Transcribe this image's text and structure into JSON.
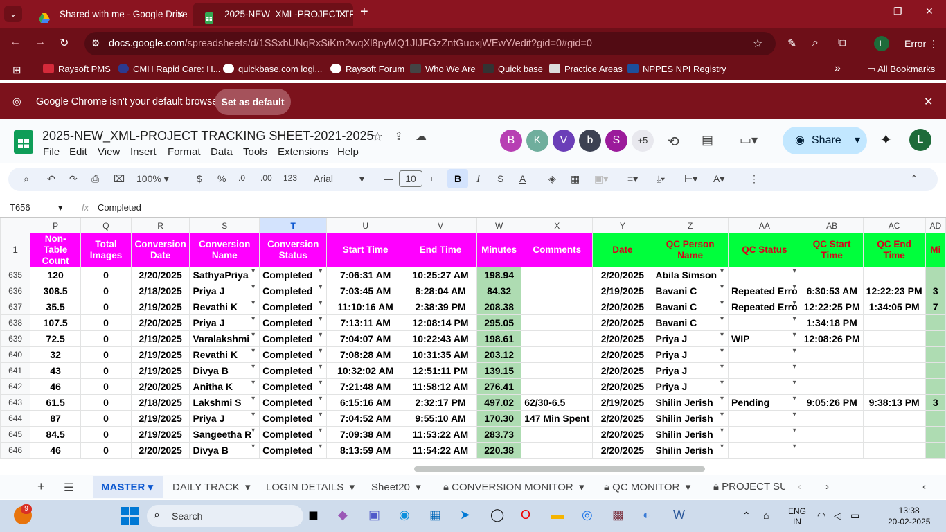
{
  "browser": {
    "tabs": [
      {
        "title": "Shared with me - Google Drive",
        "icon": "google-drive-icon"
      },
      {
        "title": "2025-NEW_XML-PROJECT TRAC",
        "icon": "google-sheets-icon"
      }
    ],
    "url_host": "docs.google.com",
    "url_path": "/spreadsheets/d/1SSxbUNqRxSiKm2wqXl8pyMQ1JlJFGzZntGuoxjWEwY/edit?gid=0#gid=0",
    "profile_initial": "L",
    "error_label": "Error",
    "bookmarks": [
      "Raysoft PMS",
      "CMH Rapid Care: H...",
      "quickbase.com logi...",
      "Raysoft Forum",
      "Who We Are",
      "Quick base",
      "Practice Areas",
      "NPPES NPI Registry"
    ],
    "all_bookmarks": "All Bookmarks",
    "infobar_text": "Google Chrome isn't your default browser",
    "set_default": "Set as default"
  },
  "sheet": {
    "title": "2025-NEW_XML-PROJECT TRACKING SHEET-2021-2025",
    "menu": [
      "File",
      "Edit",
      "View",
      "Insert",
      "Format",
      "Data",
      "Tools",
      "Extensions",
      "Help"
    ],
    "collaborators": [
      "B",
      "K",
      "V",
      "b",
      "S"
    ],
    "more_collaborators": "+5",
    "share_label": "Share",
    "user_initial": "L",
    "zoom": "100%",
    "currency": "$",
    "percent": "%",
    "dec_less": ".0",
    "dec_more": ".00",
    "number_fmt": "123",
    "font": "Arial",
    "font_size": "10",
    "name_box": "T656",
    "formula": "Completed",
    "columns": [
      "P",
      "Q",
      "R",
      "S",
      "T",
      "U",
      "V",
      "W",
      "X",
      "Y",
      "Z",
      "AA",
      "AB",
      "AC",
      "AD"
    ],
    "header_row_number": "1",
    "headers": [
      "Non-Table Count",
      "Total Images",
      "Conversion Date",
      "Conversion Name",
      "Conversion Status",
      "Start Time",
      "End Time",
      "Minutes",
      "Comments",
      "Date",
      "QC Person Name",
      "QC Status",
      "QC Start Time",
      "QC End Time",
      "Mi"
    ],
    "rows": [
      {
        "n": "635",
        "c": [
          "120",
          "0",
          "2/20/2025",
          "SathyaPriya",
          "Completed",
          "7:06:31 AM",
          "10:25:27 AM",
          "198.94",
          "",
          "2/20/2025",
          "Abila Simson",
          "",
          "",
          "",
          ""
        ]
      },
      {
        "n": "636",
        "c": [
          "308.5",
          "0",
          "2/18/2025",
          "Priya J",
          "Completed",
          "7:03:45 AM",
          "8:28:04 AM",
          "84.32",
          "",
          "2/19/2025",
          "Bavani C",
          "Repeated Erro",
          "6:30:53 AM",
          "12:22:23 PM",
          "3"
        ]
      },
      {
        "n": "637",
        "c": [
          "35.5",
          "0",
          "2/19/2025",
          "Revathi K",
          "Completed",
          "11:10:16 AM",
          "2:38:39 PM",
          "208.38",
          "",
          "2/20/2025",
          "Bavani C",
          "Repeated Erro",
          "12:22:25 PM",
          "1:34:05 PM",
          "7"
        ]
      },
      {
        "n": "638",
        "c": [
          "107.5",
          "0",
          "2/20/2025",
          "Priya J",
          "Completed",
          "7:13:11 AM",
          "12:08:14 PM",
          "295.05",
          "",
          "2/20/2025",
          "Bavani C",
          "",
          "1:34:18 PM",
          "",
          ""
        ]
      },
      {
        "n": "639",
        "c": [
          "72.5",
          "0",
          "2/19/2025",
          "Varalakshmi",
          "Completed",
          "7:04:07 AM",
          "10:22:43 AM",
          "198.61",
          "",
          "2/20/2025",
          "Priya J",
          "WIP",
          "12:08:26 PM",
          "",
          ""
        ]
      },
      {
        "n": "640",
        "c": [
          "32",
          "0",
          "2/19/2025",
          "Revathi K",
          "Completed",
          "7:08:28 AM",
          "10:31:35 AM",
          "203.12",
          "",
          "2/20/2025",
          "Priya J",
          "",
          "",
          "",
          ""
        ]
      },
      {
        "n": "641",
        "c": [
          "43",
          "0",
          "2/19/2025",
          "Divya B",
          "Completed",
          "10:32:02 AM",
          "12:51:11 PM",
          "139.15",
          "",
          "2/20/2025",
          "Priya J",
          "",
          "",
          "",
          ""
        ]
      },
      {
        "n": "642",
        "c": [
          "46",
          "0",
          "2/20/2025",
          "Anitha K",
          "Completed",
          "7:21:48 AM",
          "11:58:12 AM",
          "276.41",
          "",
          "2/20/2025",
          "Priya J",
          "",
          "",
          "",
          ""
        ]
      },
      {
        "n": "643",
        "c": [
          "61.5",
          "0",
          "2/18/2025",
          "Lakshmi S",
          "Completed",
          "6:15:16 AM",
          "2:32:17 PM",
          "497.02",
          "62/30-6.5",
          "2/19/2025",
          "Shilin Jerish",
          "Pending",
          "9:05:26 PM",
          "9:38:13 PM",
          "3"
        ]
      },
      {
        "n": "644",
        "c": [
          "87",
          "0",
          "2/19/2025",
          "Priya J",
          "Completed",
          "7:04:52 AM",
          "9:55:10 AM",
          "170.30",
          "147 Min Spent",
          "2/20/2025",
          "Shilin Jerish",
          "",
          "",
          "",
          ""
        ]
      },
      {
        "n": "645",
        "c": [
          "84.5",
          "0",
          "2/19/2025",
          "Sangeetha R",
          "Completed",
          "7:09:38 AM",
          "11:53:22 AM",
          "283.73",
          "",
          "2/20/2025",
          "Shilin Jerish",
          "",
          "",
          "",
          ""
        ]
      },
      {
        "n": "646",
        "c": [
          "46",
          "0",
          "2/20/2025",
          "Divya B",
          "Completed",
          "8:13:59 AM",
          "11:54:22 AM",
          "220.38",
          "",
          "2/20/2025",
          "Shilin Jerish",
          "",
          "",
          "",
          ""
        ]
      }
    ],
    "sheet_tabs": [
      "MASTER",
      "DAILY TRACK",
      "LOGIN DETAILS",
      "Sheet20",
      "CONVERSION MONITOR",
      "QC MONITOR",
      "PROJECT SU"
    ],
    "colors": {
      "magenta": "#ff00ff",
      "green": "#00ff3c",
      "minutes_bg": "#aedcb2",
      "chrome_red": "#8b1420"
    }
  },
  "taskbar": {
    "search": "Search",
    "notif_count": "9",
    "lang1": "ENG",
    "lang2": "IN",
    "time": "13:38",
    "date": "20-02-2025"
  }
}
